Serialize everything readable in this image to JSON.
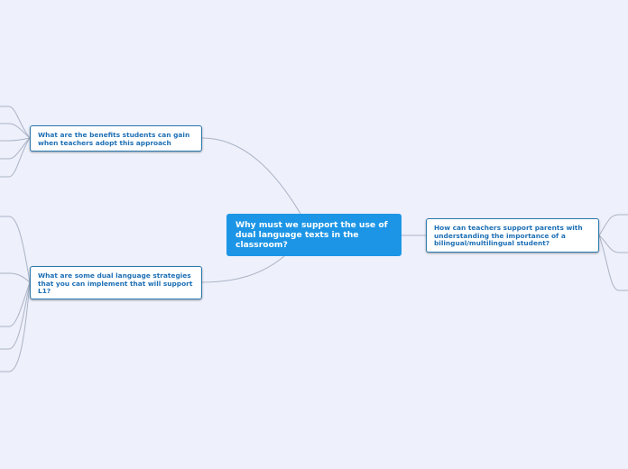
{
  "central_topic": "Why must we support the use of dual language texts in the classroom?",
  "branches": {
    "benefits": "What are the benefits students can gain when teachers adopt this approach",
    "strategies": "What are some dual language strategies that you can implement that will support L1?",
    "parents": "How can teachers support parents with understanding the importance of a bilingual/multilingual student?"
  },
  "colors": {
    "background": "#eef0fb",
    "central": "#1c95e6",
    "node_border": "#2a7ab0",
    "node_text": "#1d6fb5",
    "connector": "#aab3c5"
  }
}
